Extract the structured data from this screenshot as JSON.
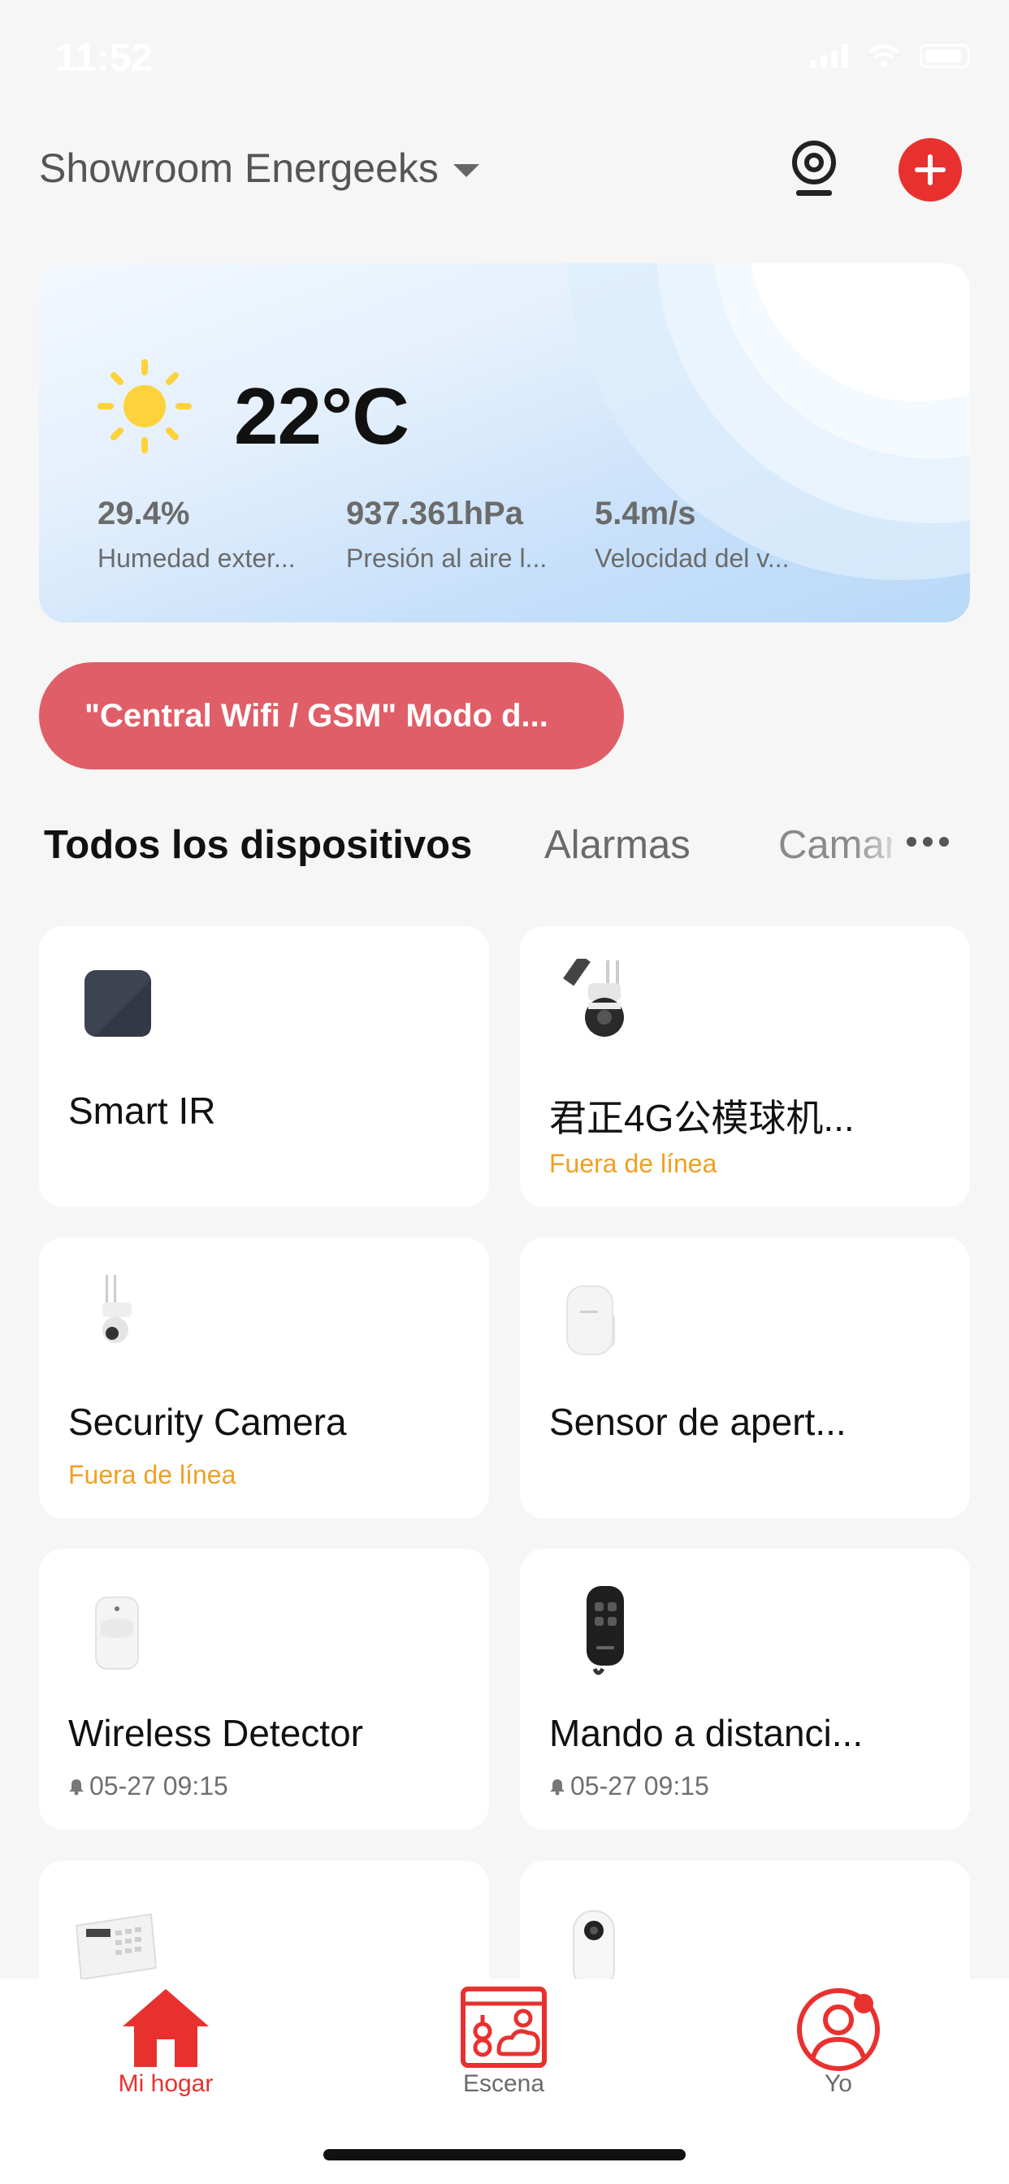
{
  "status_bar": {
    "time": "11:52"
  },
  "header": {
    "home_name": "Showroom Energeeks"
  },
  "weather": {
    "temperature": "22°C",
    "metrics": [
      {
        "value": "29.4%",
        "label": "Humedad exter..."
      },
      {
        "value": "937.361hPa",
        "label": "Presión al aire l..."
      },
      {
        "value": "5.4m/s",
        "label": "Velocidad del v..."
      }
    ]
  },
  "mode_banner": {
    "label": "\"Central Wifi / GSM\" Modo d..."
  },
  "tabs": [
    "Todos los dispositivos",
    "Alarmas",
    "Camaras"
  ],
  "devices": [
    {
      "name": "Smart IR",
      "status": "",
      "time": ""
    },
    {
      "name": "君正4G公模球机...",
      "status": "Fuera de línea",
      "time": ""
    },
    {
      "name": "Security Camera",
      "status": "Fuera de línea",
      "time": ""
    },
    {
      "name": "Sensor de apert...",
      "status": "",
      "time": ""
    },
    {
      "name": "Wireless Detector",
      "status": "",
      "time": "05-27 09:15"
    },
    {
      "name": "Mando a distanci...",
      "status": "",
      "time": "05-27 09:15"
    }
  ],
  "bottom_nav": [
    {
      "label": "Mi hogar",
      "active": true
    },
    {
      "label": "Escena",
      "active": false
    },
    {
      "label": "Yo",
      "active": false
    }
  ],
  "colors": {
    "brand": "#e8312f",
    "offline": "#f0a020",
    "banner": "#e05e68"
  }
}
